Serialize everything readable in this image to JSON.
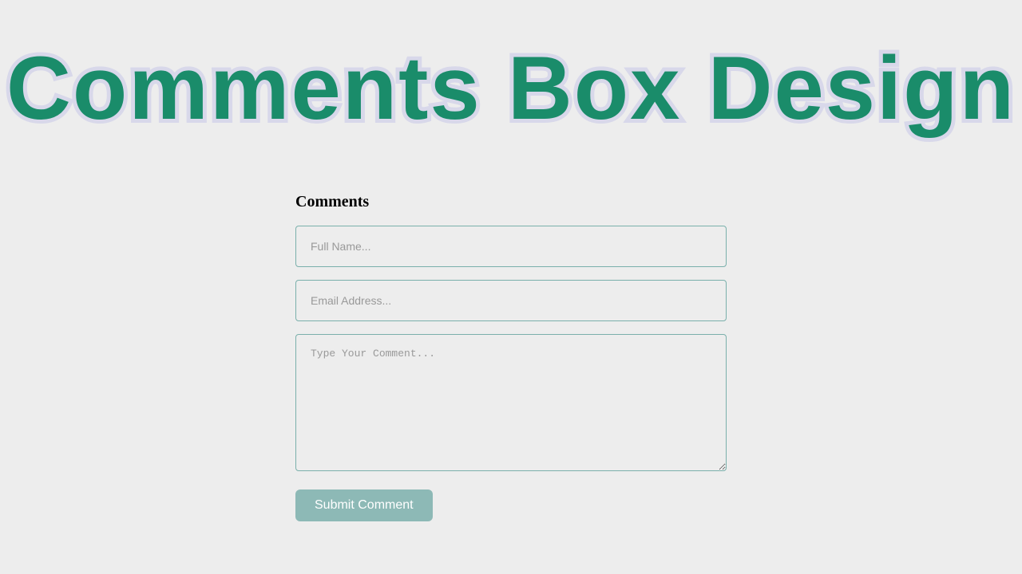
{
  "header": {
    "title": "Comments Box Design"
  },
  "form": {
    "heading": "Comments",
    "fullname": {
      "placeholder": "Full Name...",
      "value": ""
    },
    "email": {
      "placeholder": "Email Address...",
      "value": ""
    },
    "comment": {
      "placeholder": "Type Your Comment...",
      "value": ""
    },
    "submit_label": "Submit Comment"
  }
}
